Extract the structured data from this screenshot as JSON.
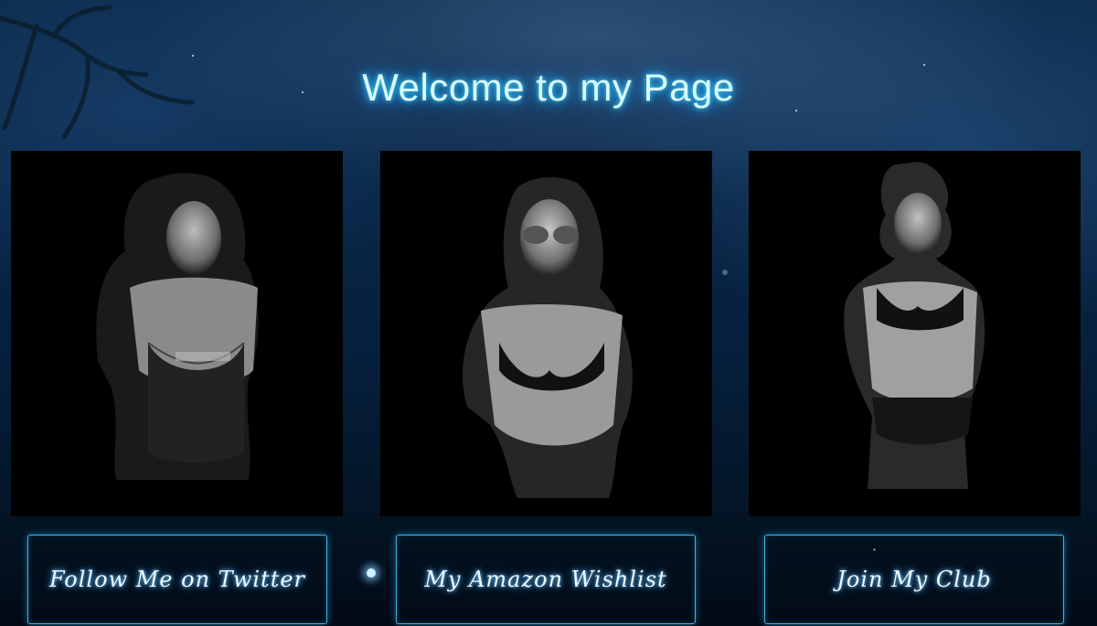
{
  "page": {
    "title": "Welcome to my Page"
  },
  "cards": [
    {
      "name": "model-photo-1",
      "alt": "black and white portrait, corset"
    },
    {
      "name": "model-photo-2",
      "alt": "black and white portrait, sunglasses"
    },
    {
      "name": "model-photo-3",
      "alt": "black and white portrait, vinyl outfit"
    }
  ],
  "buttons": {
    "twitter_label": "Follow Me on Twitter",
    "wishlist_label": "My Amazon Wishlist",
    "club_label": "Join My Club"
  },
  "colors": {
    "title_glow": "#1aa8ff",
    "button_border": "#39b7e6",
    "background": "#0a2848"
  }
}
